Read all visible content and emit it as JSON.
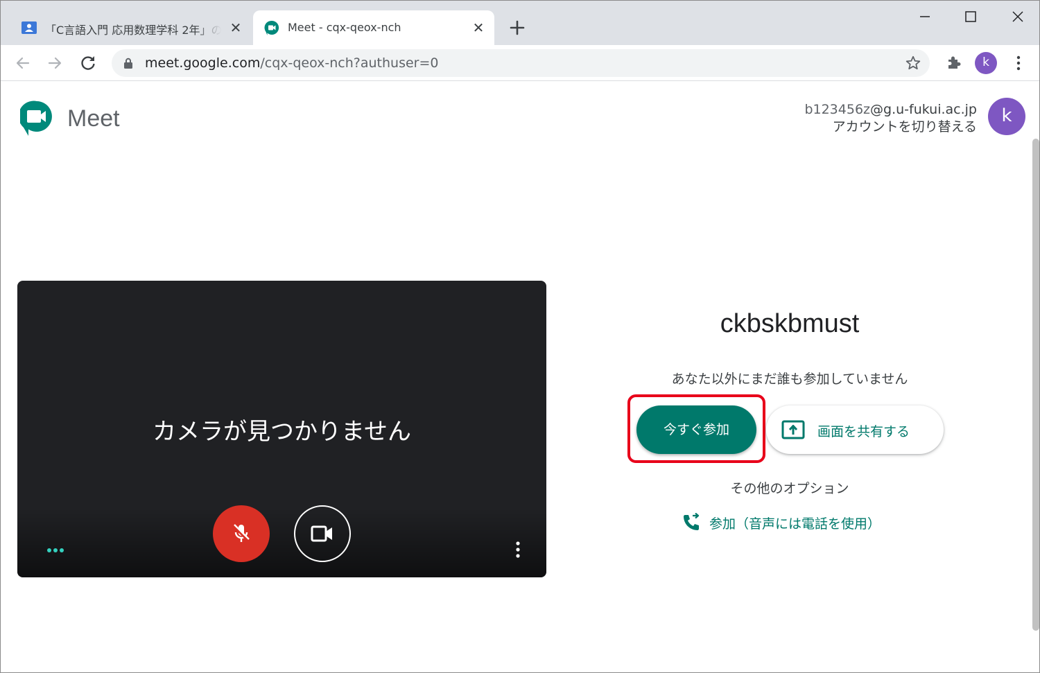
{
  "browser": {
    "tabs": [
      {
        "title": "「C言語入門 応用数理学科 2年」の",
        "active": false,
        "favicon": "classroom-icon"
      },
      {
        "title": "Meet - cqx-qeox-nch",
        "active": true,
        "favicon": "meet-icon"
      }
    ],
    "url": {
      "host": "meet.google.com",
      "path": "/cqx-qeox-nch?authuser=0"
    },
    "profile_initial": "k"
  },
  "header": {
    "app_name": "Meet",
    "account": {
      "user": "b123456z",
      "domain": "@g.u-fukui.ac.jp",
      "switch_label": "アカウントを切り替える",
      "initial": "k"
    }
  },
  "preview": {
    "message": "カメラが見つかりません",
    "mic": {
      "state": "muted",
      "icon": "mic-off-icon"
    },
    "camera": {
      "icon": "videocam-icon"
    }
  },
  "join_panel": {
    "meeting_code": "ckbskbmust",
    "status": "あなた以外にまだ誰も参加していません",
    "join_now_label": "今すぐ参加",
    "present_label": "画面を共有する",
    "other_options_label": "その他のオプション",
    "phone_join_label": "参加（音声には電話を使用）"
  },
  "colors": {
    "accent": "#00796b",
    "mic_off": "#d93025",
    "highlight": "#e8001a",
    "avatar": "#7e57c2"
  }
}
